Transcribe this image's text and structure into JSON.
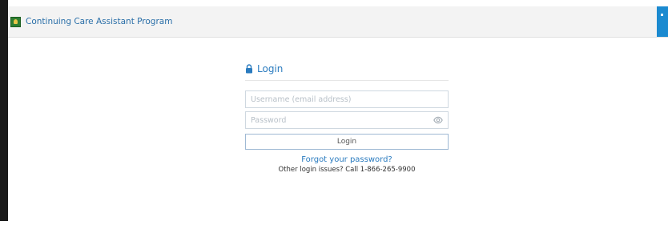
{
  "header": {
    "app_title": "Continuing Care Assistant Program",
    "logo_icon": "program-logo-icon",
    "brand_color": "#2a6fa8",
    "corner_button_color": "#1b8ad0"
  },
  "login": {
    "title": "Login",
    "lock_icon": "lock-icon",
    "username_placeholder": "Username (email address)",
    "password_placeholder": "Password",
    "eye_icon": "eye-icon",
    "button_label": "Login",
    "forgot_link": "Forgot your password?",
    "other_issues": "Other login issues? Call 1-866-265-9900",
    "accent_color": "#2a7bbf"
  }
}
